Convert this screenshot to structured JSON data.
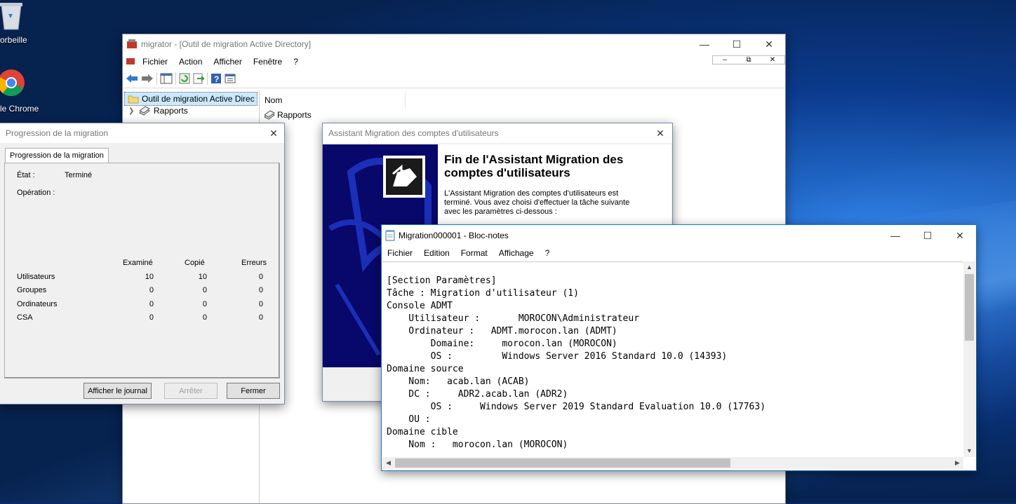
{
  "desktop": {
    "icons": [
      {
        "label": "orbeille",
        "icon": "recycle-bin-icon"
      },
      {
        "label": "le Chrome",
        "icon": "chrome-icon"
      }
    ]
  },
  "mmc": {
    "title": "migrator - [Outil de migration Active Directory]",
    "menu": [
      "Fichier",
      "Action",
      "Afficher",
      "Fenêtre",
      "?"
    ],
    "tree": {
      "root": "Outil de migration Active Direc",
      "child": "Rapports"
    },
    "list": {
      "column_header": "Nom",
      "items": [
        "Rapports"
      ]
    }
  },
  "progress": {
    "title": "Progression de la migration",
    "tab": "Progression de la migration",
    "state_label": "État :",
    "state_value": "Terminé",
    "operation_label": "Opération :",
    "columns": [
      "Examiné",
      "Copié",
      "Erreurs"
    ],
    "rows": [
      {
        "label": "Utilisateurs",
        "values": [
          "10",
          "10",
          "0"
        ]
      },
      {
        "label": "Groupes",
        "values": [
          "0",
          "0",
          "0"
        ]
      },
      {
        "label": "Ordinateurs",
        "values": [
          "0",
          "0",
          "0"
        ]
      },
      {
        "label": "CSA",
        "values": [
          "0",
          "0",
          "0"
        ]
      }
    ],
    "buttons": {
      "log": "Afficher le journal",
      "stop": "Arrêter",
      "close": "Fermer"
    }
  },
  "wizard": {
    "title": "Assistant Migration des comptes d'utilisateurs",
    "heading": "Fin de l'Assistant Migration des comptes d'utilisateurs",
    "text": "L'Assistant Migration des comptes d'utilisateurs est terminé. Vous avez choisi d'effectuer la tâche suivante avec les paramètres ci-dessous :"
  },
  "notepad": {
    "title": "Migration000001 - Bloc-notes",
    "menu": [
      "Fichier",
      "Edition",
      "Format",
      "Affichage",
      "?"
    ],
    "lines": [
      "[Section Paramètres]",
      "Tâche : Migration d'utilisateur (1)",
      "Console ADMT",
      "    Utilisateur :       MOROCON\\Administrateur",
      "    Ordinateur :   ADMT.morocon.lan (ADMT)",
      "        Domaine:     morocon.lan (MOROCON)",
      "        OS :         Windows Server 2016 Standard 10.0 (14393)",
      "Domaine source",
      "    Nom:   acab.lan (ACAB)",
      "    DC :     ADR2.acab.lan (ADR2)",
      "        OS :     Windows Server 2019 Standard Evaluation 10.0 (17763)",
      "    OU :",
      "Domaine cible",
      "    Nom :   morocon.lan (MOROCON)"
    ]
  },
  "colors": {
    "accent": "#0078d7",
    "wizard_banner": "#0a0a8c"
  }
}
